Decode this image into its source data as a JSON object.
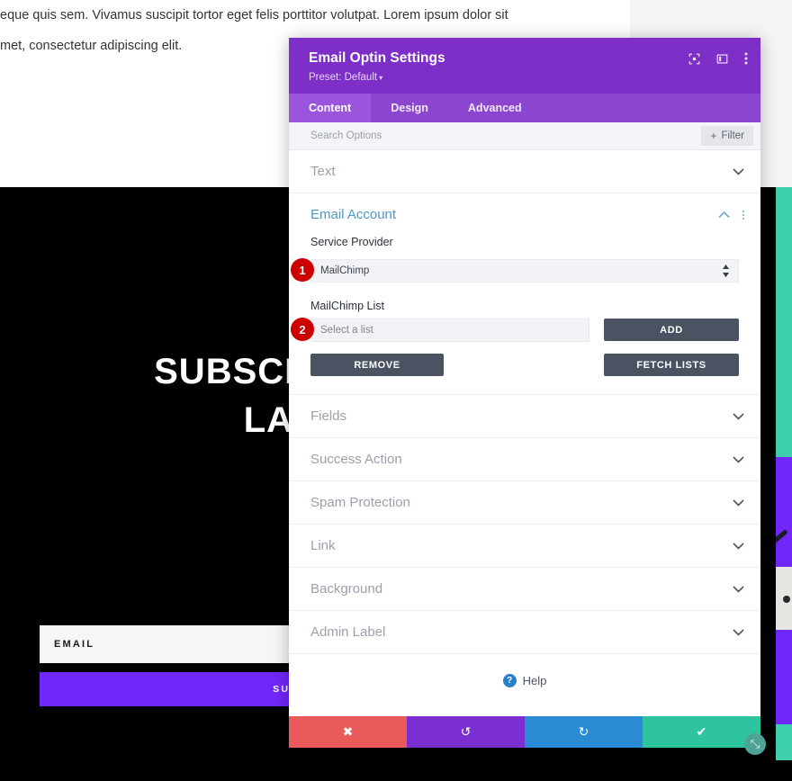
{
  "background": {
    "paragraph_line_1": "eque quis sem. Vivamus suscipit tortor eget felis porttitor volutpat. Lorem ipsum dolor sit",
    "paragraph_line_2": "met, consectetur adipiscing elit.",
    "hero": {
      "heading_line_1": "SUBSCRIBE TO O",
      "heading_line_2": "LATEST",
      "email_placeholder": "EMAIL",
      "subscribe_label": "SUBSCRIBE"
    }
  },
  "modal": {
    "title": "Email Optin Settings",
    "preset": "Preset: Default",
    "preset_caret": "▾",
    "header_icons": [
      {
        "name": "focus-target-icon",
        "glyph": "◙"
      },
      {
        "name": "panel-layout-icon",
        "glyph": "▣"
      },
      {
        "name": "kebab-menu-icon",
        "glyph": "⋮"
      }
    ],
    "tabs": [
      {
        "label": "Content",
        "active": true
      },
      {
        "label": "Design",
        "active": false
      },
      {
        "label": "Advanced",
        "active": false
      }
    ],
    "search": {
      "placeholder": "Search Options",
      "filter_label": "Filter",
      "filter_plus": "+"
    },
    "sections": [
      {
        "title": "Text",
        "state": "collapsed",
        "chevron": "⌄"
      },
      {
        "title": "Email Account",
        "state": "expanded",
        "chevron": "⌃"
      },
      {
        "title": "Fields",
        "state": "collapsed",
        "chevron": "⌄"
      },
      {
        "title": "Success Action",
        "state": "collapsed",
        "chevron": "⌄"
      },
      {
        "title": "Spam Protection",
        "state": "collapsed",
        "chevron": "⌄"
      },
      {
        "title": "Link",
        "state": "collapsed",
        "chevron": "⌄"
      },
      {
        "title": "Background",
        "state": "collapsed",
        "chevron": "⌄"
      },
      {
        "title": "Admin Label",
        "state": "collapsed",
        "chevron": "⌄"
      }
    ],
    "email_account": {
      "service_provider_label": "Service Provider",
      "service_provider_value": "MailChimp",
      "list_label": "MailChimp List",
      "list_value": "Select a list",
      "add_label": "ADD",
      "remove_label": "REMOVE",
      "fetch_lists_label": "FETCH LISTS",
      "badge_1": "1",
      "badge_2": "2"
    },
    "help": {
      "label": "Help",
      "icon_glyph": "?"
    },
    "footer": [
      {
        "name": "cancel",
        "glyph": "✖"
      },
      {
        "name": "undo",
        "glyph": "↺"
      },
      {
        "name": "redo",
        "glyph": "↻"
      },
      {
        "name": "save",
        "glyph": "✔"
      }
    ]
  },
  "colors": {
    "header_purple": "#7d2fc7",
    "tabs_purple": "#8c45cf",
    "tab_active_purple": "#9b55dd",
    "section_open_blue": "#4e98c6",
    "badge_red": "#cc0000",
    "button_dark": "#4b5362",
    "footer_cancel": "#eb5a5a",
    "footer_undo": "#7b2fd1",
    "footer_redo": "#2a8ad4",
    "footer_save": "#2ec4a0",
    "hero_purple": "#7127fa",
    "accent_teal": "#3ed0ae"
  },
  "resize_handle": {
    "glyph": "⤡"
  }
}
